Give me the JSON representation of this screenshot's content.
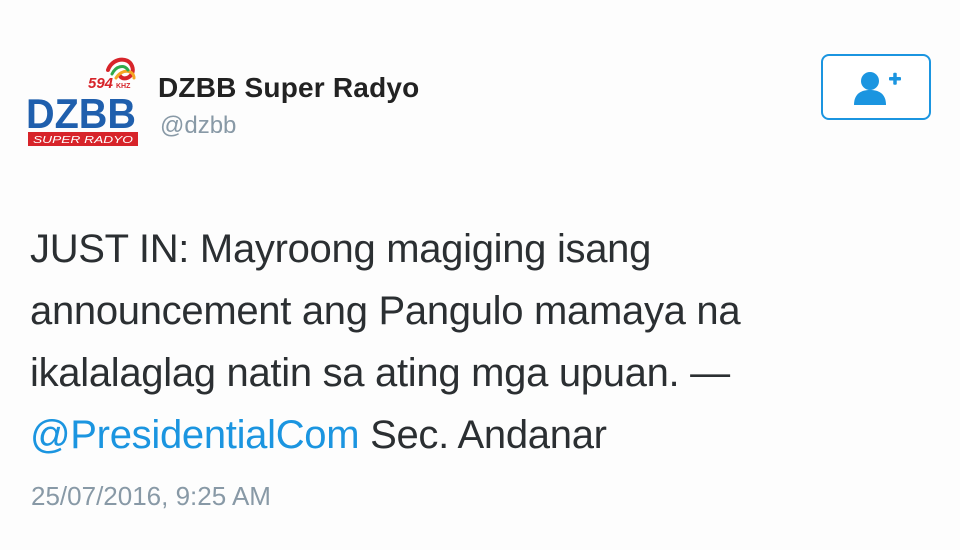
{
  "account": {
    "display_name": "DZBB Super Radyo",
    "handle": "@dzbb",
    "logo": {
      "frequency": "594",
      "frequency_unit": "KHZ",
      "call_sign": "DZBB",
      "tagline": "SUPER RADYO"
    }
  },
  "follow_button": {
    "icon": "add-user-icon"
  },
  "tweet": {
    "line1": "JUST IN: Mayroong magiging isang",
    "line2": "announcement ang Pangulo mamaya na",
    "line3": "ikalalaglag natin sa ating mga upuan. —",
    "mention": "@PresidentialCom",
    "line4_rest": " Sec. Andanar",
    "timestamp": "25/07/2016, 9:25 AM"
  },
  "colors": {
    "accent": "#1b95e0",
    "text": "#2b2f32",
    "muted": "#8899a6",
    "logo_blue": "#1f5fad",
    "logo_red": "#d7242a"
  }
}
